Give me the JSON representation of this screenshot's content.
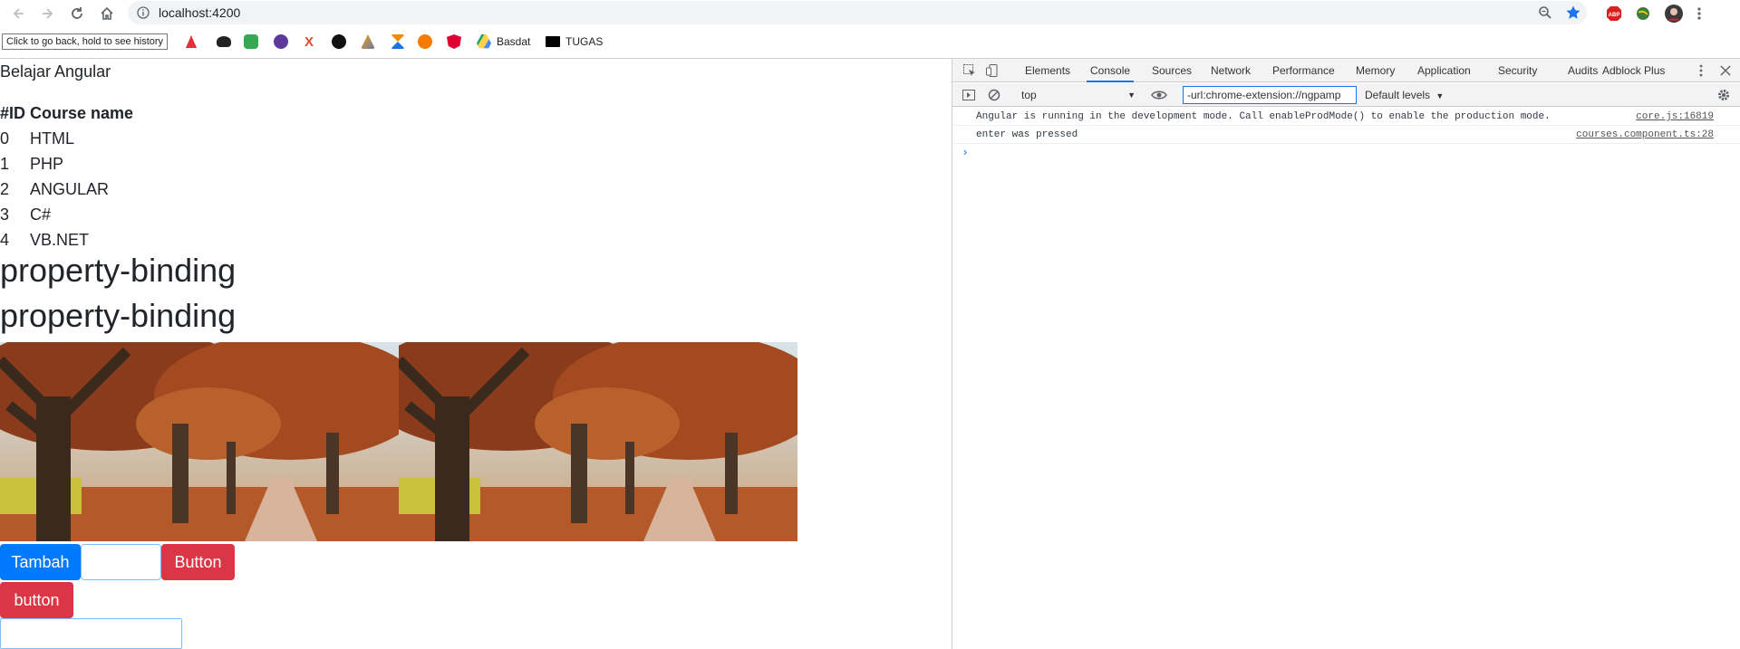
{
  "browser": {
    "url": "localhost:4200",
    "tooltip": "Click to go back, hold to see history",
    "bookmarks": [
      {
        "label": "",
        "icon": "angular-red-icon",
        "color": "#e23237"
      },
      {
        "label": "",
        "icon": "hat-icon",
        "color": "#222222"
      },
      {
        "label": "",
        "icon": "green-icon",
        "color": "#34a853"
      },
      {
        "label": "",
        "icon": "seal-icon",
        "color": "#5b3a9b"
      },
      {
        "label": "",
        "icon": "x-icon",
        "color": "#e04a2f"
      },
      {
        "label": "",
        "icon": "github-icon",
        "color": "#111111"
      },
      {
        "label": "",
        "icon": "pma-icon",
        "color": "#f0a30a"
      },
      {
        "label": "",
        "icon": "hourglass-icon",
        "color": "#1a73e8"
      },
      {
        "label": "",
        "icon": "play-icon",
        "color": "#f57c00"
      },
      {
        "label": "",
        "icon": "angular-icon",
        "color": "#dd0031"
      },
      {
        "label": "Basdat",
        "icon": "google-drive-icon",
        "color": "#1fa463"
      },
      {
        "label": "TUGAS",
        "icon": "tugas-icon",
        "color": "#000000"
      }
    ]
  },
  "page": {
    "title": "Belajar Angular",
    "table": {
      "headers": [
        "#ID",
        "Course name"
      ],
      "rows": [
        [
          "0",
          "HTML"
        ],
        [
          "1",
          "PHP"
        ],
        [
          "2",
          "ANGULAR"
        ],
        [
          "3",
          "C#"
        ],
        [
          "4",
          "VB.NET"
        ]
      ]
    },
    "heading1": "property-binding",
    "heading2": "property-binding",
    "btn_tambah": "Tambah",
    "btn_button": "Button",
    "btn_button2": "button"
  },
  "devtools": {
    "tabs": [
      "Elements",
      "Console",
      "Sources",
      "Network",
      "Performance",
      "Memory",
      "Application",
      "Security",
      "Audits",
      "Adblock Plus"
    ],
    "active_tab": "Console",
    "context": "top",
    "filter": "-url:chrome-extension://ngpamp",
    "levels": "Default levels",
    "logs": [
      {
        "message": "Angular is running in the development mode. Call enableProdMode() to enable the production mode.",
        "source": "core.js:16819"
      },
      {
        "message": "enter was pressed",
        "source": "courses.component.ts:28"
      }
    ]
  },
  "colors": {
    "primary": "#007bff",
    "danger": "#dc3545",
    "devtools_accent": "#1a73e8"
  }
}
